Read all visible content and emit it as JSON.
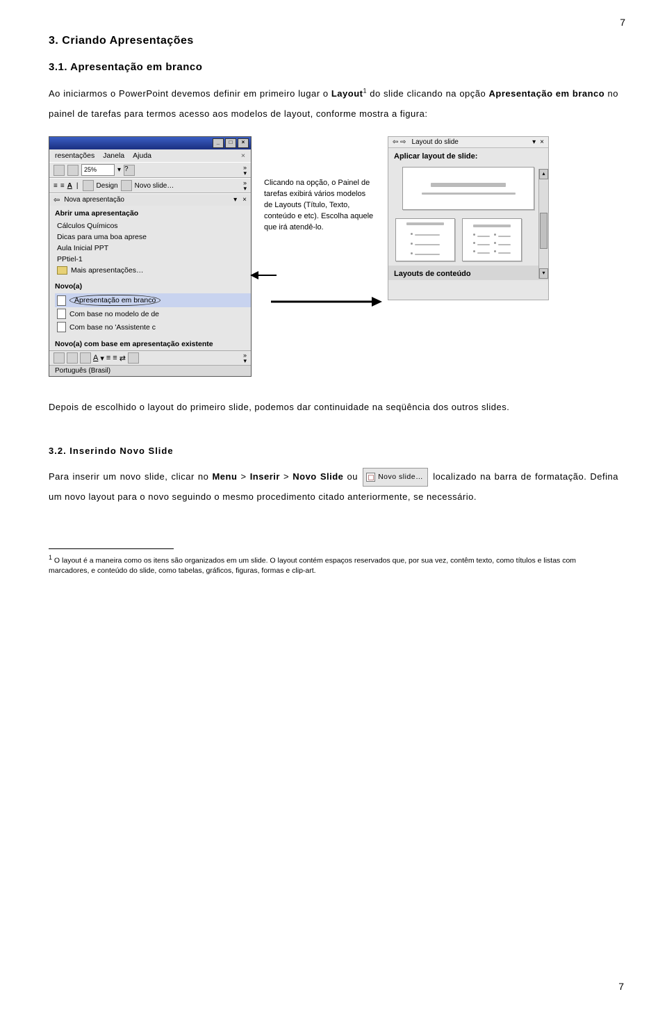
{
  "page_number_top": "7",
  "page_number_bottom": "7",
  "h1": "3. Criando Apresentações",
  "s31": {
    "heading": "3.1.  Apresentação em branco",
    "p1_a": "Ao iniciarmos o PowerPoint devemos definir em primeiro lugar o ",
    "p1_layout": "Layout",
    "p1_sup": "1",
    "p1_b": " do slide clicando na opção ",
    "p1_bold2": "Apresentação em branco",
    "p1_c": " no painel de tarefas para termos acesso aos modelos de layout, conforme mostra a figura:"
  },
  "callout": "Clicando na opção, o Painel de tarefas exibirá vários modelos de Layouts (Título, Texto, conteúdo e etc). Escolha aquele que irá atendê-lo.",
  "p_after_figs": "Depois de escolhido o layout do primeiro slide, podemos dar continuidade na seqüência dos outros slides.",
  "s32": {
    "heading": "3.2.  Inserindo Novo Slide",
    "p1_a": "Para inserir um novo slide, clicar no ",
    "menu": "Menu",
    "gt1": " > ",
    "inserir": "Inserir",
    "gt2": " > ",
    "novo_slide": "Novo Slide",
    "p1_b": "  ou  ",
    "inline_btn": "Novo slide…",
    "p1_c": "  localizado na barra de formatação. Defina um novo layout para o novo seguindo o mesmo procedimento citado anteriormente, se necessário."
  },
  "footnote": {
    "sup": "1",
    "text": " O layout é a maneira como os itens são organizados em um slide. O layout contém espaços reservados que, por sua vez, contêm texto, como títulos e listas com marcadores, e conteúdo do slide, como tabelas, gráficos, figuras, formas e clip-art."
  },
  "fig_left": {
    "menus": [
      "resentações",
      "Janela",
      "Ajuda"
    ],
    "zoom": "25%",
    "tb2": [
      "Design",
      "Novo slide…"
    ],
    "pane_hdr": "Nova apresentação",
    "sect_open": "Abrir uma apresentação",
    "open_items": [
      "Cálculos Químicos",
      "Dicas para uma boa aprese",
      "Aula Inicial PPT",
      "PPtiel-1",
      "Mais apresentações…"
    ],
    "sect_new": "Novo(a)",
    "new_items": [
      "Apresentação em branco",
      "Com base no modelo de de",
      "Com base no 'Assistente c"
    ],
    "sect_base": "Novo(a) com base em apresentação existente",
    "status": "Português (Brasil)"
  },
  "fig_right": {
    "hdr": "Layout do slide",
    "sect1": "Aplicar layout de slide:",
    "sect2": "Layouts de conteúdo"
  }
}
